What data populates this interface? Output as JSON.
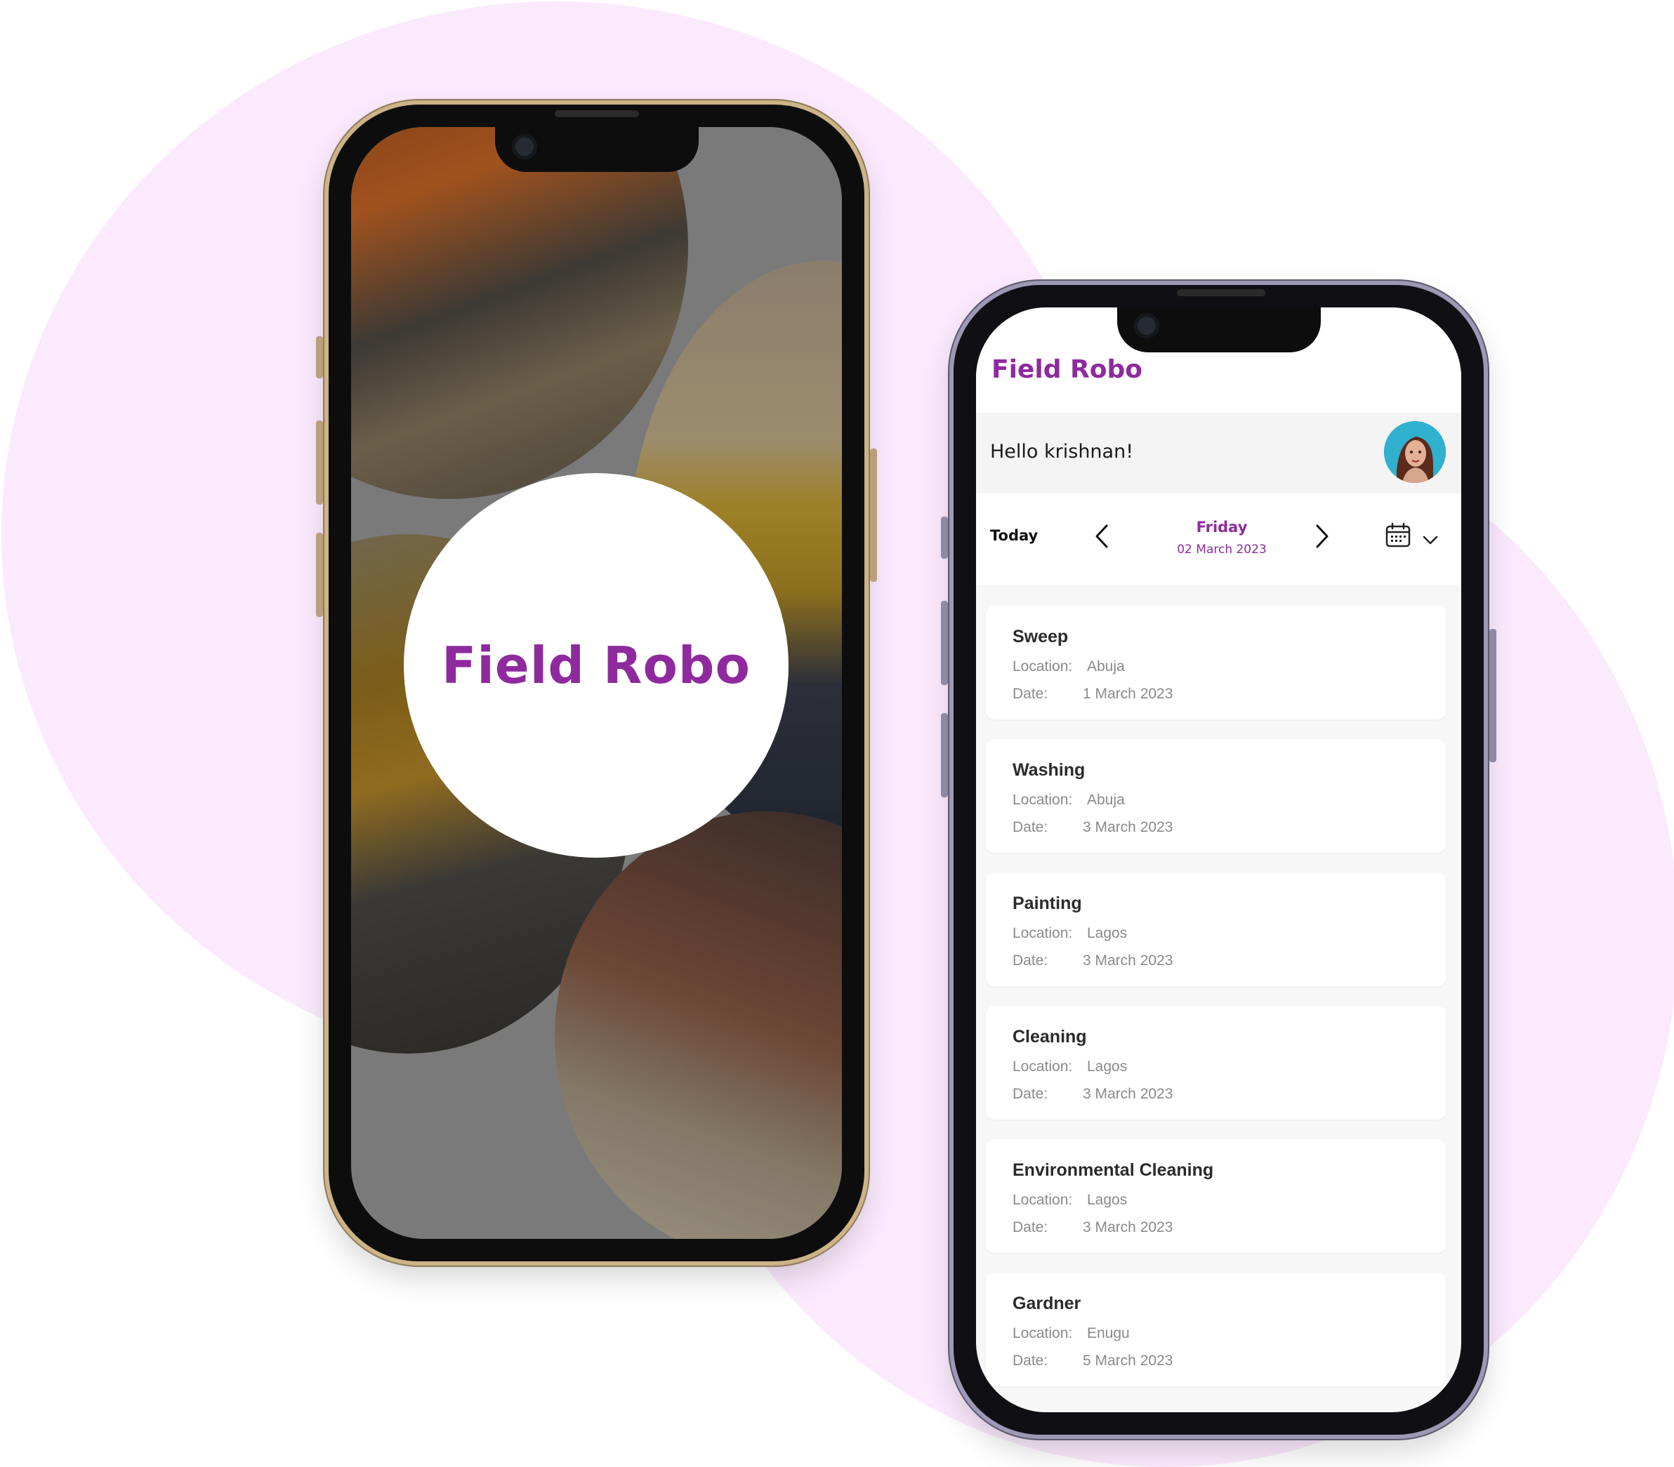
{
  "splash": {
    "title": "Field Robo"
  },
  "app": {
    "title": "Field Robo",
    "greeting": "Hello krishnan!",
    "date_nav": {
      "today_label": "Today",
      "day_name": "Friday",
      "date": "02 March 2023"
    },
    "location_label": "Location:",
    "date_label": "Date:",
    "tasks": [
      {
        "title": "Sweep",
        "location": "Abuja",
        "date": "1 March 2023"
      },
      {
        "title": "Washing",
        "location": "Abuja",
        "date": "3 March 2023"
      },
      {
        "title": "Painting",
        "location": "Lagos",
        "date": "3 March 2023"
      },
      {
        "title": "Cleaning",
        "location": "Lagos",
        "date": "3 March 2023"
      },
      {
        "title": "Environmental Cleaning",
        "location": "Lagos",
        "date": "3 March 2023"
      },
      {
        "title": "Gardner",
        "location": "Enugu",
        "date": "5 March 2023"
      }
    ]
  },
  "colors": {
    "brand": "#8e2a9e",
    "background_blob": "#fbeafd",
    "card": "#ffffff",
    "screen_bg": "#f7f7f7"
  },
  "icons": [
    "chevron-left-icon",
    "chevron-right-icon",
    "calendar-icon",
    "chevron-down-icon",
    "avatar"
  ]
}
